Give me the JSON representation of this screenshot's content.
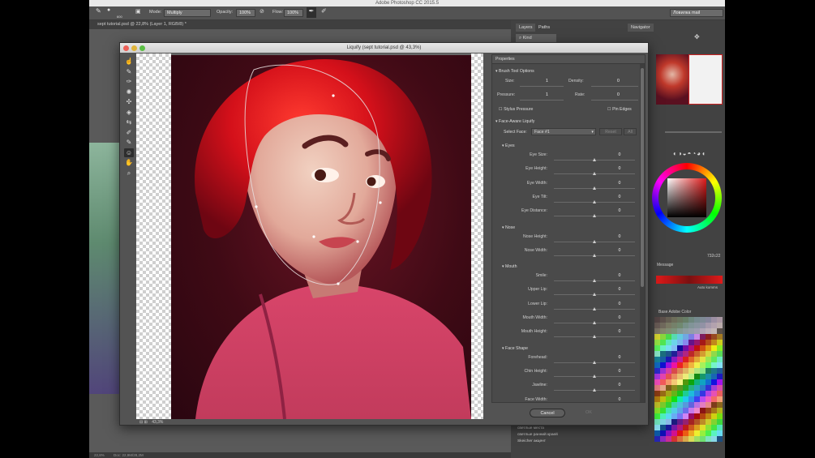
{
  "app": {
    "title": "Adobe Photoshop CC 2015.5"
  },
  "options_bar": {
    "brush_size": "600",
    "mode_label": "Mode:",
    "mode_value": "Multiply",
    "opacity_label": "Opacity:",
    "opacity_value": "100%",
    "flow_label": "Flow:",
    "flow_value": "100%",
    "workspace_value": "Ловилка mail"
  },
  "document": {
    "tab_title": "sept tutorial.psd @ 22,8% (Layer 1, RGB/8) *",
    "status_zoom": "22,8%",
    "status_doc": "Doc: 22,9M/28,2M"
  },
  "panels": {
    "layers_tab": "Layers",
    "paths_tab": "Paths",
    "navigator_tab": "Navigator",
    "kind_label": "Kind",
    "hex_value": "732c22",
    "messages_label": "Message",
    "swatches_label": "Base Adobe Color",
    "auto_label": "Auto komms",
    "layers": [
      "светлые места",
      "светлые ранний краей",
      "Skeicher акцент"
    ]
  },
  "colors": {
    "accent": "#e01a1a",
    "dialog_bg": "#535353",
    "panel_bg": "#4a4a4a"
  },
  "liquify": {
    "title": "Liquify (sept tutorial.psd @ 43,3%)",
    "zoom": "43,3%",
    "tools": [
      "forward-warp-icon",
      "reconstruct-icon",
      "smooth-icon",
      "twirl-icon",
      "pucker-icon",
      "bloat-icon",
      "push-left-icon",
      "freeze-mask-icon",
      "thaw-mask-icon",
      "face-tool-icon",
      "hand-icon",
      "zoom-icon"
    ],
    "properties": {
      "header": "Properties",
      "brush_section": "Brush Tool Options",
      "size_label": "Size:",
      "size_value": "1",
      "density_label": "Density:",
      "density_value": "0",
      "pressure_label": "Pressure:",
      "pressure_value": "1",
      "rate_label": "Rate:",
      "rate_value": "0",
      "stylus_label": "Stylus Pressure",
      "pin_edges_label": "Pin Edges",
      "face_section": "Face-Aware Liquify",
      "select_face_label": "Select Face:",
      "select_face_value": "Face #1",
      "reset_label": "Reset",
      "all_label": "All",
      "groups": [
        {
          "name": "Eyes",
          "rows": [
            {
              "label": "Eye Size:",
              "value": "0"
            },
            {
              "label": "Eye Height:",
              "value": "0"
            },
            {
              "label": "Eye Width:",
              "value": "0"
            },
            {
              "label": "Eye Tilt:",
              "value": "0"
            },
            {
              "label": "Eye Distance:",
              "value": "0"
            }
          ]
        },
        {
          "name": "Nose",
          "rows": [
            {
              "label": "Nose Height:",
              "value": "0"
            },
            {
              "label": "Nose Width:",
              "value": "0"
            }
          ]
        },
        {
          "name": "Mouth",
          "rows": [
            {
              "label": "Smile:",
              "value": "0"
            },
            {
              "label": "Upper Lip:",
              "value": "0"
            },
            {
              "label": "Lower Lip:",
              "value": "0"
            },
            {
              "label": "Mouth Width:",
              "value": "0"
            },
            {
              "label": "Mouth Height:",
              "value": "0"
            }
          ]
        },
        {
          "name": "Face Shape",
          "rows": [
            {
              "label": "Forehead:",
              "value": "0"
            },
            {
              "label": "Chin Height:",
              "value": "0"
            },
            {
              "label": "Jawline:",
              "value": "0"
            },
            {
              "label": "Face Width:",
              "value": "0"
            }
          ]
        }
      ]
    },
    "cancel_label": "Cancel",
    "ok_label": "OK"
  }
}
